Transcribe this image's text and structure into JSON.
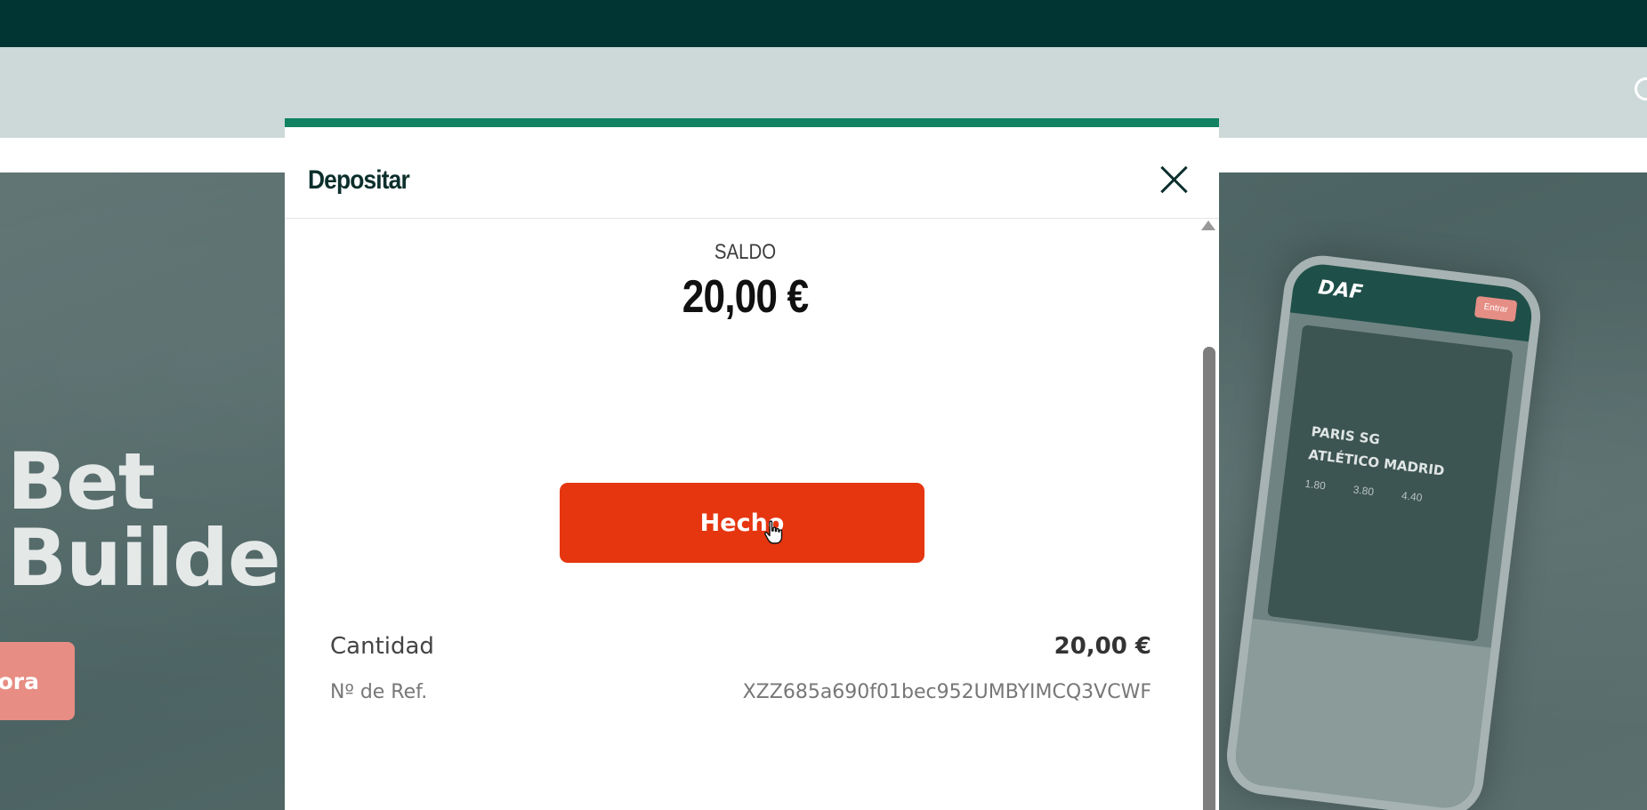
{
  "background": {
    "hero": {
      "title_line1": "Bet",
      "title_line2": "Builde",
      "cta_label": "ora"
    },
    "phone": {
      "logo": "DAF",
      "button": "Entrar",
      "team1": "PARIS SG",
      "team2": "ATLÉTICO MADRID",
      "odds": "1.80 3.80 4.40"
    }
  },
  "modal": {
    "title": "Depositar",
    "close_icon": "close-icon",
    "balance": {
      "label": "SALDO",
      "value": "20,00 €"
    },
    "done_button": "Hecho",
    "details": {
      "amount_label": "Cantidad",
      "amount_value": "20,00 €",
      "ref_label": "Nº de Ref.",
      "ref_value": "XZZ685a690f01bec952UMBYIMCQ3VCWF"
    }
  },
  "colors": {
    "topbar": "#003533",
    "accent": "#118262",
    "done_button": "#e63610"
  }
}
